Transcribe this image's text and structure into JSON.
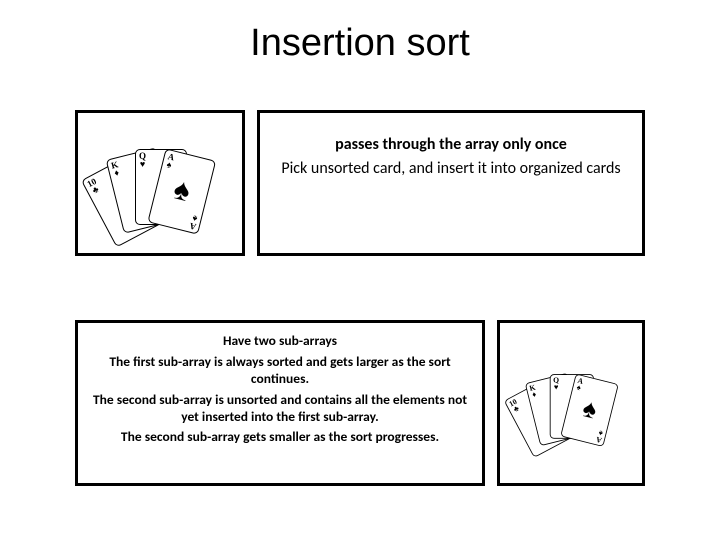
{
  "title": "Insertion sort",
  "box1": {
    "bold": "passes through the array only once",
    "desc": "Pick unsorted card, and insert it into organized cards"
  },
  "box2": {
    "l1": "Have two sub-arrays",
    "l2": "The first sub-array is always sorted and gets larger as the sort continues.",
    "l3": "The second sub-array is unsorted and contains all the elements not yet inserted into the first sub-array.",
    "l4": "The second sub-array gets smaller as the sort progresses."
  },
  "cards": {
    "ranks": [
      "10",
      "K",
      "Q",
      "A"
    ],
    "suits": [
      "♣",
      "♦",
      "♥",
      "♠"
    ]
  }
}
